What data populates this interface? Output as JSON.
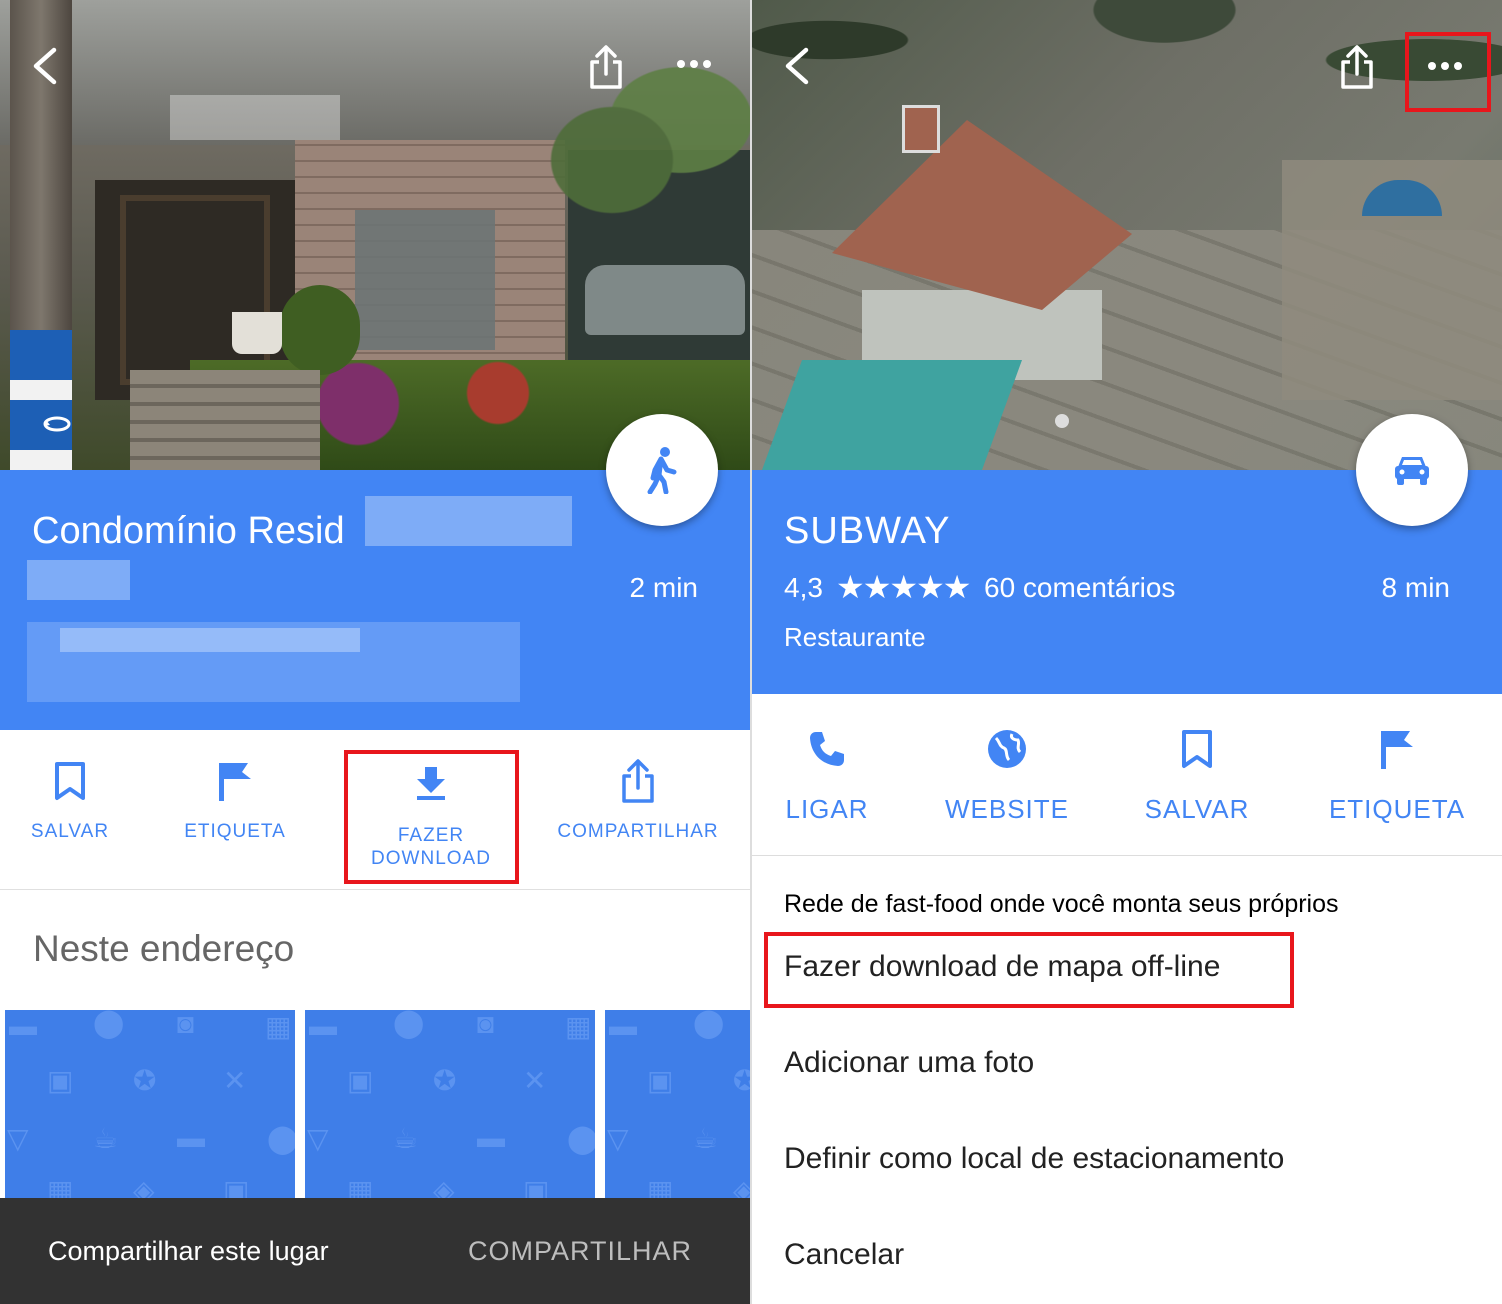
{
  "left": {
    "place_title": "Condomínio Resid",
    "eta": "2 min",
    "actions": [
      {
        "label": "SALVAR"
      },
      {
        "label": "ETIQUETA"
      },
      {
        "label": "FAZER DOWNLOAD"
      },
      {
        "label": "COMPARTILHAR"
      }
    ],
    "section_title": "Neste endereço",
    "snackbar": {
      "message": "Compartilhar este lugar",
      "action": "COMPARTILHAR"
    }
  },
  "right": {
    "place_title": "SUBWAY",
    "rating": "4,3",
    "stars": "★★★★★",
    "reviews": "60 comentários",
    "eta": "8 min",
    "category": "Restaurante",
    "actions": [
      {
        "label": "LIGAR"
      },
      {
        "label": "WEBSITE"
      },
      {
        "label": "SALVAR"
      },
      {
        "label": "ETIQUETA"
      }
    ],
    "description": "Rede de fast-food onde você monta seus próprios",
    "menu": [
      {
        "label": "Fazer download de mapa off-line"
      },
      {
        "label": "Adicionar uma foto"
      },
      {
        "label": "Definir como local de estacionamento"
      },
      {
        "label": "Cancelar"
      }
    ]
  },
  "colors": {
    "accent": "#4285f4",
    "highlight": "#e8161c",
    "snackbar": "#323232"
  }
}
